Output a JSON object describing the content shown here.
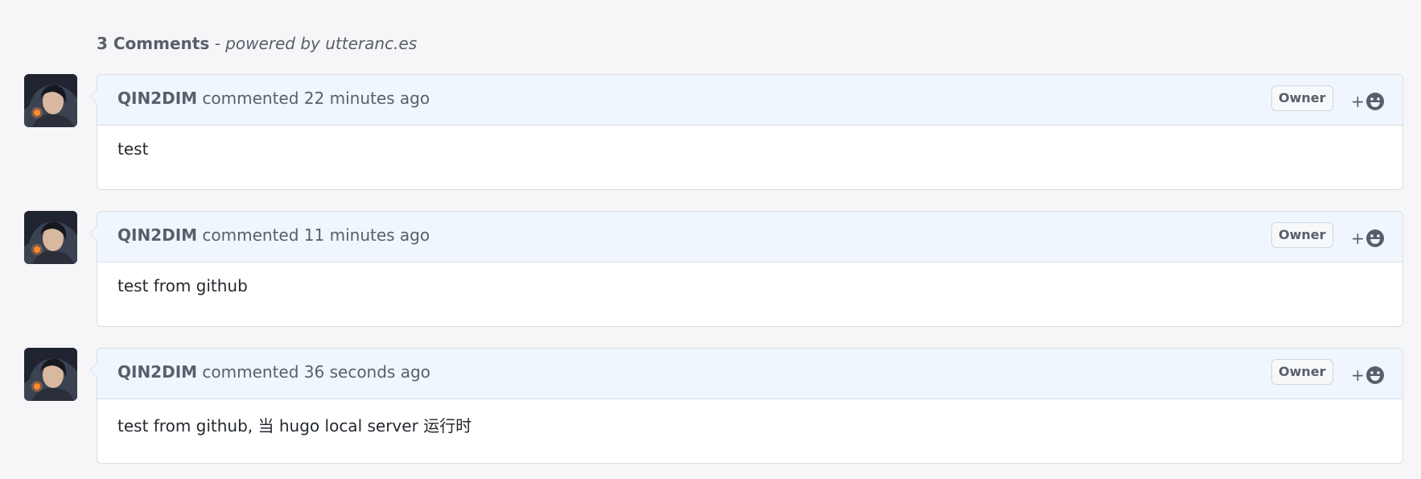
{
  "timeline": {
    "count_label": "3 Comments",
    "powered_by": "- powered by utteranc.es"
  },
  "comments": [
    {
      "author": "QIN2DIM",
      "action": "commented",
      "time": "22 minutes ago",
      "badge": "Owner",
      "reaction_plus": "+",
      "body": "test"
    },
    {
      "author": "QIN2DIM",
      "action": "commented",
      "time": "11 minutes ago",
      "badge": "Owner",
      "reaction_plus": "+",
      "body": "test from github"
    },
    {
      "author": "QIN2DIM",
      "action": "commented",
      "time": "36 seconds ago",
      "badge": "Owner",
      "reaction_plus": "+",
      "body": "test from github, 当 hugo local server 运行时"
    }
  ],
  "icons": {
    "reaction": "smiley-icon",
    "avatar": "user-avatar"
  },
  "colors": {
    "page_bg": "#f6f6f9",
    "header_bg": "#eff6fe",
    "border": "#d8dee4",
    "muted_text": "#57606a"
  }
}
